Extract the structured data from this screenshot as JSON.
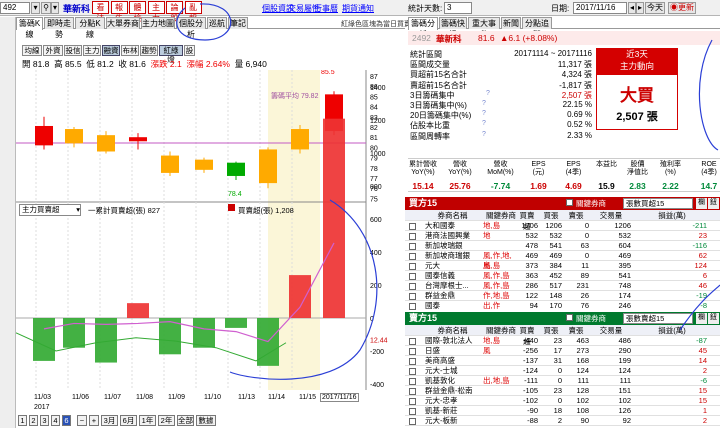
{
  "topbar": {
    "code": "492",
    "name": "華新科",
    "btns": [
      "看法",
      "報告",
      "體檢",
      "主力",
      "論股",
      "亂報"
    ],
    "links": [
      "個股資訊",
      "交易屬性",
      "行事曆",
      "期貨通知"
    ],
    "day_label": "統計天數:",
    "day_value": "3",
    "date_label": "日期:",
    "date_value": "2017/11/16",
    "today": "今天",
    "refresh": "更新"
  },
  "left_tabs": [
    "籌碼K線",
    "即時走勢",
    "分點K線",
    "大單券商",
    "主力地圖",
    "個股分析",
    "巡航",
    "筆記"
  ],
  "left_tab_right": "紅綠色區塊為當日買賣",
  "indicator_btns": [
    "均線",
    "外資",
    "投信",
    "主力",
    "融資",
    "布林",
    "趨勢",
    "紅綠燈",
    "設"
  ],
  "ohlc": {
    "open": "開 81.8",
    "high": "高 85.5",
    "low": "低 81.2",
    "close": "收 81.6",
    "chg": "漲跌 2.1",
    "pct": "漲幅 2.64%",
    "vol": "量 6,940"
  },
  "avg_label": "籌碼平均 79.82",
  "price_high": "85.5",
  "price_low": "78.4",
  "price_axis": [
    "87",
    "86",
    "85",
    "84",
    "83",
    "82",
    "81",
    "80",
    "79",
    "78",
    "77",
    "76",
    "75"
  ],
  "vol_select": "主力買賣超",
  "vol_legend1": "一累計買賣超(張) 827",
  "vol_legend2": "買賣超(張) 1,208",
  "vol_axis": [
    "1400",
    "1200",
    "1000",
    "800",
    "600",
    "400",
    "200",
    "0",
    "-200",
    "-400",
    "-600"
  ],
  "vol_marker": "12.44",
  "x_dates": [
    "11/03",
    "11/06",
    "11/07",
    "11/08",
    "11/09",
    "11/10",
    "11/13",
    "11/14",
    "11/15"
  ],
  "x_year": "2017",
  "x_current": "2017/11/16",
  "bottom_btns": [
    "1",
    "2",
    "3",
    "4",
    "6",
    "1m",
    "3月",
    "6月",
    "1年",
    "2年",
    "全部",
    "數據"
  ],
  "right_tabs": [
    "籌碼分析",
    "籌碼快訊",
    "重大事件",
    "新聞",
    "分點追蹤"
  ],
  "stock": {
    "code": "2492",
    "name": "華新科",
    "price": "81.6",
    "change": "▲6.1 (+8.08%)"
  },
  "stats": [
    [
      "統計區間",
      "20171114 ~ 20171116"
    ],
    [
      "區間成交量",
      "11,317 張"
    ],
    [
      "買超前15名合計",
      "4,324 張"
    ],
    [
      "賣超前15名合計",
      "-1,817 張"
    ],
    [
      "3日籌碼集中",
      "2,507 張"
    ],
    [
      "3日籌碼集中(%)",
      "22.15 %"
    ],
    [
      "20日籌碼集中(%)",
      "0.69 %"
    ],
    [
      "佔股本比重",
      "0.52 %"
    ],
    [
      "區間周轉率",
      "2.33 %"
    ]
  ],
  "trend": {
    "line1": "近3天",
    "line2": "主力動向",
    "verdict": "大買",
    "amount": "2,507 張"
  },
  "metrics": {
    "headers": [
      "累計營收\nYoY(%)",
      "營收\nYoY(%)",
      "營收\nMoM(%)",
      "EPS\n(元)",
      "EPS\n(4季)",
      "本益比",
      "股價\n淨值比",
      "殖利率\n(%)",
      "ROE\n(4季)"
    ],
    "values": [
      "15.14",
      "25.76",
      "-7.74",
      "1.69",
      "4.69",
      "15.9",
      "2.83",
      "2.22",
      "14.7"
    ]
  },
  "buy": {
    "title": "買方15",
    "select_label": "關鍵券商",
    "select_value": "張數買超15",
    "tool1": "欄",
    "tool2": "鈕",
    "cols": [
      "券商名稱",
      "關鍵券商",
      "買賣超",
      "買張",
      "賣張",
      "交易量",
      "損益(萬)"
    ],
    "rows": [
      [
        "大和國泰",
        "地,島",
        "1206",
        "1206",
        "0",
        "1206",
        "-211"
      ],
      [
        "港商法國興業",
        "地",
        "532",
        "532",
        "0",
        "532",
        "23"
      ],
      [
        "新加坡瑞銀",
        "",
        "478",
        "541",
        "63",
        "604",
        "-116"
      ],
      [
        "新加坡商瑞銀",
        "風,作,地,島",
        "469",
        "469",
        "0",
        "469",
        "62"
      ],
      [
        "元大",
        "風,島",
        "373",
        "384",
        "11",
        "395",
        "124"
      ],
      [
        "國泰信義",
        "風,作,島",
        "363",
        "452",
        "89",
        "541",
        "6"
      ],
      [
        "台灣摩根士...",
        "風,作,島",
        "286",
        "517",
        "231",
        "748",
        "46"
      ],
      [
        "群益金鼎",
        "作,地,島",
        "122",
        "148",
        "26",
        "174",
        "-19"
      ],
      [
        "國泰",
        "出,作",
        "94",
        "170",
        "76",
        "246",
        "-8"
      ]
    ]
  },
  "sell": {
    "title": "賣方15",
    "select_label": "關鍵券商",
    "select_value": "張數賣超15",
    "tool1": "欄",
    "tool2": "鈕",
    "cols": [
      "券商名稱",
      "關鍵券商",
      "買賣超",
      "買張",
      "賣張",
      "交易量",
      "損益(萬)"
    ],
    "rows": [
      [
        "國際-敦北法人",
        "地,島",
        "-440",
        "23",
        "463",
        "486",
        "-87"
      ],
      [
        "日盛",
        "風",
        "-256",
        "17",
        "273",
        "290",
        "45"
      ],
      [
        "美商高盛",
        "",
        "-137",
        "31",
        "168",
        "199",
        "14"
      ],
      [
        "元大-士城",
        "",
        "-124",
        "0",
        "124",
        "124",
        "2"
      ],
      [
        "凱基敦化",
        "出,地,島",
        "-111",
        "0",
        "111",
        "111",
        "-6"
      ],
      [
        "群益金鼎-松南",
        "",
        "-105",
        "23",
        "128",
        "151",
        "15"
      ],
      [
        "元大-忠孝",
        "",
        "-102",
        "0",
        "102",
        "102",
        "15"
      ],
      [
        "凱基-新莊",
        "",
        "-90",
        "18",
        "108",
        "126",
        "1"
      ],
      [
        "元大-板新",
        "",
        "-88",
        "2",
        "90",
        "92",
        "2"
      ]
    ]
  }
}
